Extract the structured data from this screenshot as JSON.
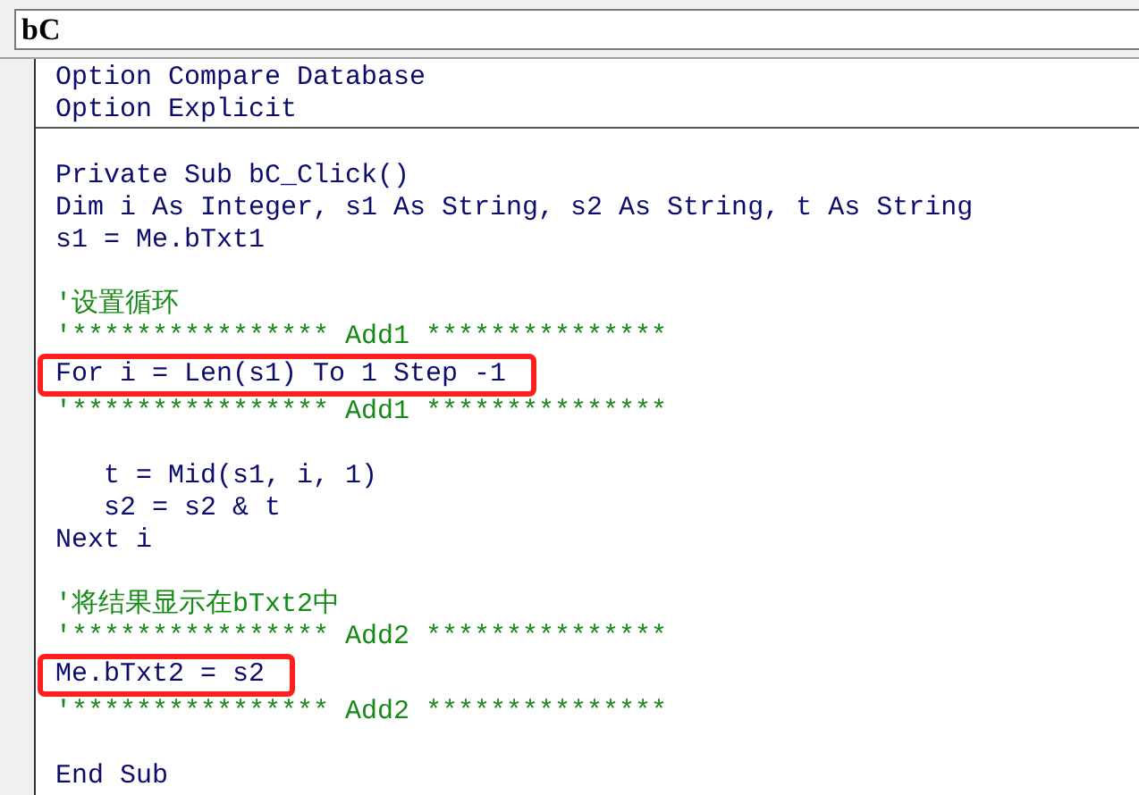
{
  "object_box": {
    "value": "bC"
  },
  "sections": [
    {
      "lines": [
        {
          "kind": "code",
          "text": "Option Compare Database",
          "highlighted": false
        },
        {
          "kind": "code",
          "text": "Option Explicit",
          "highlighted": false
        }
      ]
    },
    {
      "lines": [
        {
          "kind": "blank"
        },
        {
          "kind": "code",
          "text": "Private Sub bC_Click()",
          "highlighted": false
        },
        {
          "kind": "code",
          "text": "Dim i As Integer, s1 As String, s2 As String, t As String",
          "highlighted": false
        },
        {
          "kind": "code",
          "text": "s1 = Me.bTxt1",
          "highlighted": false
        },
        {
          "kind": "blank"
        },
        {
          "kind": "comment",
          "text": "'设置循环",
          "highlighted": false
        },
        {
          "kind": "comment",
          "text": "'**************** Add1 ***************",
          "highlighted": false
        },
        {
          "kind": "code",
          "text": "For i = Len(s1) To 1 Step -1",
          "highlighted": true
        },
        {
          "kind": "comment",
          "text": "'**************** Add1 ***************",
          "highlighted": false
        },
        {
          "kind": "blank"
        },
        {
          "kind": "code",
          "text": "   t = Mid(s1, i, 1)",
          "highlighted": false
        },
        {
          "kind": "code",
          "text": "   s2 = s2 & t",
          "highlighted": false
        },
        {
          "kind": "code",
          "text": "Next i",
          "highlighted": false
        },
        {
          "kind": "blank"
        },
        {
          "kind": "comment",
          "text": "'将结果显示在bTxt2中",
          "highlighted": false
        },
        {
          "kind": "comment",
          "text": "'**************** Add2 ***************",
          "highlighted": false
        },
        {
          "kind": "code",
          "text": "Me.bTxt2 = s2",
          "highlighted": true
        },
        {
          "kind": "comment",
          "text": "'**************** Add2 ***************",
          "highlighted": false
        },
        {
          "kind": "blank"
        },
        {
          "kind": "code",
          "text": "End Sub",
          "highlighted": false
        }
      ]
    }
  ]
}
